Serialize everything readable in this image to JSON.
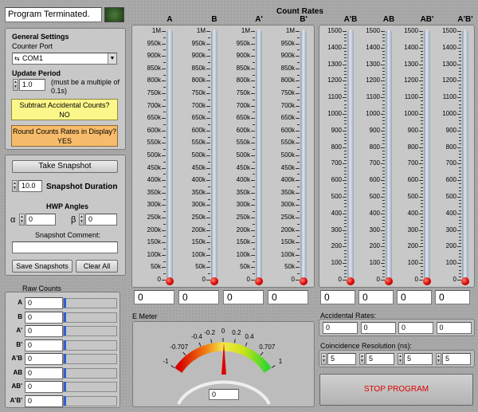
{
  "status": {
    "text": "Program Terminated."
  },
  "settings": {
    "general_title": "General Settings",
    "counter_port_label": "Counter Port",
    "counter_port_value": "COM1",
    "update_period_label": "Update Period",
    "update_period_value": "1.0",
    "update_period_note": "(must be a multiple of 0.1s)",
    "subtract_button": "Subtract Accidental Counts?",
    "subtract_value": "NO",
    "round_button": "Round Counts Rates in Display?",
    "round_value": "YES"
  },
  "snapshot": {
    "take_button": "Take Snapshot",
    "duration_value": "10.0",
    "duration_label": "Snapshot Duration",
    "hwp_title": "HWP Angles",
    "alpha_label": "α",
    "alpha_value": "0",
    "beta_label": "β",
    "beta_value": "0",
    "comment_label": "Snapshot Comment:",
    "comment_value": "",
    "save_button": "Save Snapshots",
    "clear_button": "Clear All"
  },
  "raw_counts": {
    "title": "Raw Counts",
    "rows": [
      {
        "label": "A",
        "value": "0"
      },
      {
        "label": "B",
        "value": "0"
      },
      {
        "label": "A'",
        "value": "0"
      },
      {
        "label": "B'",
        "value": "0"
      },
      {
        "label": "A'B",
        "value": "0"
      },
      {
        "label": "AB",
        "value": "0"
      },
      {
        "label": "AB'",
        "value": "0"
      },
      {
        "label": "A'B'",
        "value": "0"
      }
    ]
  },
  "count_rates": {
    "title": "Count Rates",
    "singles": {
      "ticks": [
        "1M",
        "950k",
        "900k",
        "850k",
        "800k",
        "750k",
        "700k",
        "650k",
        "600k",
        "550k",
        "500k",
        "450k",
        "400k",
        "350k",
        "300k",
        "250k",
        "200k",
        "150k",
        "100k",
        "50k",
        "0"
      ],
      "channels": [
        {
          "label": "A",
          "value": "0"
        },
        {
          "label": "B",
          "value": "0"
        },
        {
          "label": "A'",
          "value": "0"
        },
        {
          "label": "B'",
          "value": "0"
        }
      ]
    },
    "coincidences": {
      "ticks": [
        "1500",
        "1400",
        "1300",
        "1200",
        "1100",
        "1000",
        "900",
        "800",
        "700",
        "600",
        "500",
        "400",
        "300",
        "200",
        "100",
        "0"
      ],
      "channels": [
        {
          "label": "A'B",
          "value": "0"
        },
        {
          "label": "AB",
          "value": "0"
        },
        {
          "label": "AB'",
          "value": "0"
        },
        {
          "label": "A'B'",
          "value": "0"
        }
      ]
    }
  },
  "emeter": {
    "title": "E Meter",
    "scale_labels": [
      "-1",
      "-0.707",
      "-0.4",
      "-0.2",
      "0",
      "0.2",
      "0.4",
      "0.707",
      "1"
    ],
    "value": "0"
  },
  "accidentals": {
    "title": "Accidental Rates:",
    "values": [
      "0",
      "0",
      "0",
      "0"
    ]
  },
  "resolution": {
    "title": "Coincidence Resolution (ns):",
    "values": [
      "5",
      "5",
      "5",
      "5"
    ]
  },
  "stop": {
    "label": "STOP PROGRAM"
  }
}
